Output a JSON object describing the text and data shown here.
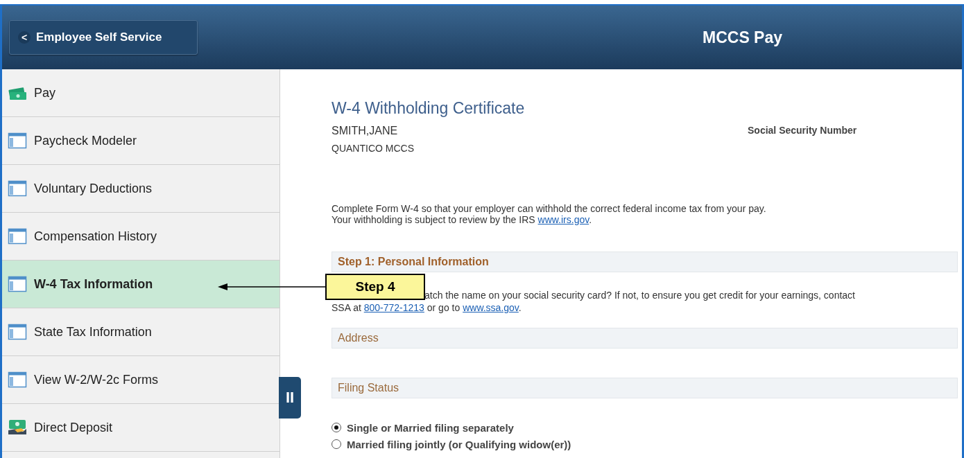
{
  "header": {
    "back_button": {
      "icon": "<",
      "label": "Employee Self Service"
    },
    "title": "MCCS Pay"
  },
  "sidebar": {
    "items": [
      {
        "label": "Pay",
        "kind": "cash",
        "selected": false
      },
      {
        "label": "Paycheck Modeler",
        "kind": "page",
        "selected": false
      },
      {
        "label": "Voluntary Deductions",
        "kind": "page",
        "selected": false
      },
      {
        "label": "Compensation History",
        "kind": "page",
        "selected": false
      },
      {
        "label": "W-4 Tax Information",
        "kind": "page",
        "selected": true
      },
      {
        "label": "State Tax Information",
        "kind": "page",
        "selected": false
      },
      {
        "label": "View W-2/W-2c Forms",
        "kind": "page",
        "selected": false
      },
      {
        "label": "Direct Deposit",
        "kind": "deposit",
        "selected": false
      }
    ]
  },
  "collapse_handle": {
    "icon": "II"
  },
  "content": {
    "title": "W-4 Withholding Certificate",
    "employee_name": "SMITH,JANE",
    "location": "QUANTICO MCCS",
    "ssn_label": "Social Security Number",
    "intro": [
      "Complete Form W-4 so that your employer can withhold the correct federal income tax from your pay.",
      "Your withholding is subject to review by the IRS "
    ],
    "irs_link": "www.irs.gov",
    "intro_end": ".",
    "step1_heading": "Step 1: Personal Information",
    "step1_text": "atch the name on your social security card? If not, to ensure you get credit for your earnings, contact",
    "step1_line2_prefix": "SSA at ",
    "phone_link": "800-772-1213",
    "step1_line2_mid": " or go to ",
    "ssa_link": "www.ssa.gov",
    "step1_line2_end": ".",
    "address_heading": "Address",
    "filing_heading": "Filing Status",
    "filing_options": [
      {
        "label": "Single or Married filing separately",
        "selected": true
      },
      {
        "label": "Married filing jointly (or Qualifying widow(er))",
        "selected": false
      }
    ]
  },
  "callout": {
    "label": "Step 4"
  }
}
